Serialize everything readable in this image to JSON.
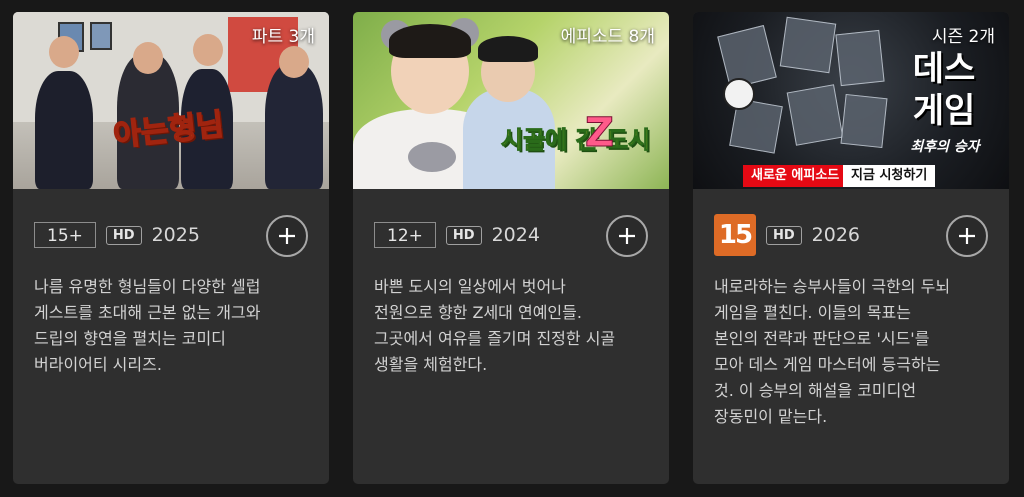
{
  "cards": [
    {
      "title_overlay": "아는형님",
      "count": "파트 3개",
      "maturity": "15+",
      "quality": "HD",
      "year": "2025",
      "description": "나름 유명한 형님들이 다양한 셀럽\n게스트를 초대해 근본 없는 개그와\n드립의 향연을 펼치는 코미디\n버라이어티 시리즈."
    },
    {
      "title_overlay": "시골에 간 도시",
      "title_overlay_z": "Z",
      "count": "에피소드 8개",
      "maturity": "12+",
      "quality": "HD",
      "year": "2024",
      "description": "바쁜 도시의 일상에서 벗어나\n전원으로 향한 Z세대 연예인들.\n그곳에서 여유를 즐기며 진정한 시골\n생활을 체험한다."
    },
    {
      "title_overlay": "데스\n게임",
      "subtitle_overlay": "최후의 승자",
      "tag_new": "새로운 에피소드",
      "tag_watch": "지금 시청하기",
      "count": "시즌 2개",
      "maturity": "15",
      "quality": "HD",
      "year": "2026",
      "description": "내로라하는 승부사들이 극한의 두뇌\n게임을 펼친다. 이들의 목표는\n본인의 전략과 판단으로 '시드'를\n모아 데스 게임 마스터에 등극하는\n것. 이 승부의 해설을 코미디언\n장동민이 맡는다."
    }
  ],
  "icons": {
    "add": "plus-icon",
    "rating_badge": "rating-15-icon"
  },
  "colors": {
    "background": "#181818",
    "card": "#2f2f2f",
    "rating_orange": "#de6b26",
    "accent_red": "#e50914"
  }
}
